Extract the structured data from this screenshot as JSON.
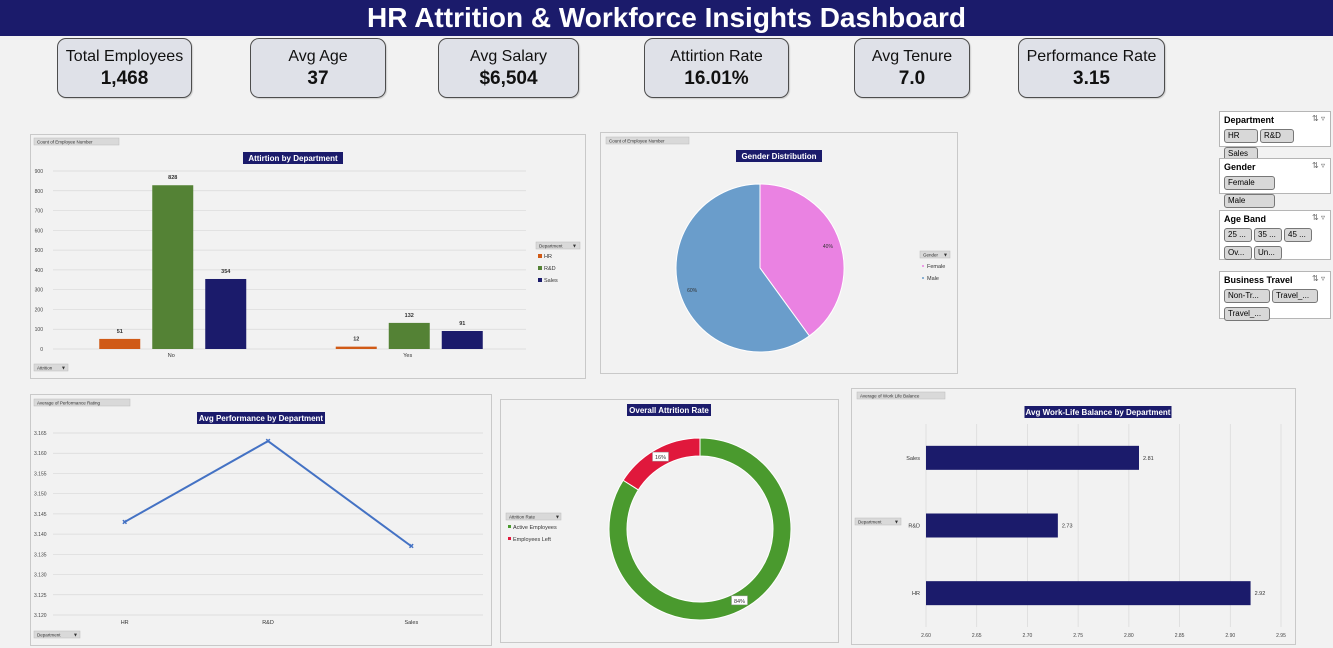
{
  "title": "HR Attrition & Workforce Insights Dashboard",
  "kpis": [
    {
      "label": "Total Employees",
      "value": "1,468"
    },
    {
      "label": "Avg Age",
      "value": "37"
    },
    {
      "label": "Avg Salary",
      "value": "$6,504"
    },
    {
      "label": "Attirtion Rate",
      "value": "16.01%"
    },
    {
      "label": "Avg Tenure",
      "value": "7.0"
    },
    {
      "label": "Performance Rate",
      "value": "3.15"
    }
  ],
  "slicers": [
    {
      "title": "Department",
      "items": [
        "HR",
        "R&D",
        "Sales"
      ]
    },
    {
      "title": "Gender",
      "items": [
        "Female",
        "Male"
      ]
    },
    {
      "title": "Age Band",
      "items": [
        "25 ...",
        "35 ...",
        "45 ...",
        "Ov...",
        "Un..."
      ]
    },
    {
      "title": "Business Travel",
      "items": [
        "Non-Tr...",
        "Travel_...",
        "Travel_..."
      ]
    }
  ],
  "colors": {
    "hr": "#d05a16",
    "rnd": "#548235",
    "sales": "#1b1b6b",
    "female": "#ea82e2",
    "male": "#6a9dcb",
    "active": "#4a9a2e",
    "left": "#e0183c",
    "line": "#4472c4",
    "header": "#1b1b6b"
  },
  "chart_data": [
    {
      "type": "bar",
      "title": "Attirtion by Department",
      "field_button": "Count of Employee Number",
      "axis_field": "Attrition",
      "legend_title": "Department",
      "categories": [
        "No",
        "Yes"
      ],
      "series": [
        {
          "name": "HR",
          "values": [
            51,
            12
          ]
        },
        {
          "name": "R&D",
          "values": [
            828,
            132
          ]
        },
        {
          "name": "Sales",
          "values": [
            354,
            91
          ]
        }
      ],
      "ylim": [
        0,
        900
      ],
      "yticks": [
        "0",
        "100",
        "200",
        "300",
        "400",
        "500",
        "600",
        "700",
        "800",
        "900"
      ],
      "grid": true,
      "legend": "right"
    },
    {
      "type": "pie",
      "title": "Gender Distribution",
      "field_button": "Count of Employee Number",
      "legend_title": "Gender",
      "labels": [
        "Female",
        "Male"
      ],
      "values": [
        40,
        60
      ],
      "data_labels": [
        "40%",
        "60%"
      ],
      "legend": "right"
    },
    {
      "type": "line",
      "title": "Avg Performance by Department",
      "field_button": "Average of Performance Rating",
      "axis_field": "Department",
      "categories": [
        "HR",
        "R&D",
        "Sales"
      ],
      "values": [
        3.143,
        3.163,
        3.137
      ],
      "ylim": [
        3.12,
        3.165
      ],
      "yticks": [
        "3.120",
        "3.125",
        "3.130",
        "3.135",
        "3.140",
        "3.145",
        "3.150",
        "3.155",
        "3.160",
        "3.165"
      ],
      "grid": true
    },
    {
      "type": "pie",
      "title": "Overall Attrition Rate",
      "legend_title": "Attrition Rate",
      "labels": [
        "Active Employees",
        "Employees Left"
      ],
      "values": [
        84,
        16
      ],
      "data_labels": [
        "84%",
        "16%"
      ],
      "legend": "left"
    },
    {
      "type": "bar",
      "title": "Avg Work-Life Balance by Department",
      "field_button": "Average of Work Life Balance",
      "axis_field": "Department",
      "categories": [
        "Sales",
        "R&D",
        "HR"
      ],
      "values": [
        2.81,
        2.73,
        2.92
      ],
      "data_labels": [
        "2.81",
        "2.73",
        "2.92"
      ],
      "xlim": [
        2.6,
        2.95
      ],
      "xticks": [
        "2.60",
        "2.65",
        "2.70",
        "2.75",
        "2.80",
        "2.85",
        "2.90",
        "2.95"
      ],
      "grid": true
    }
  ]
}
